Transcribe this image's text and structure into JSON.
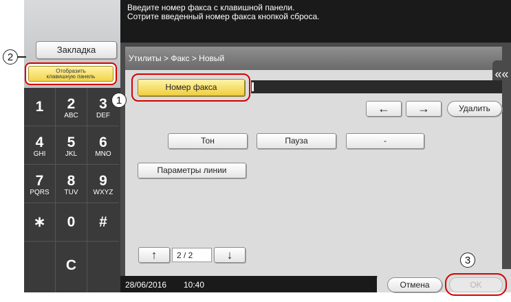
{
  "header": {
    "line1": "Введите номер факса с клавишной панели.",
    "line2": "Сотрите введенный номер факса кнопкой сброса."
  },
  "left": {
    "bookmark_label": "Закладка",
    "show_keypad_label_line1": "Отобразить",
    "show_keypad_label_line2": "клавишную панель"
  },
  "keypad": {
    "keys": [
      {
        "digit": "1",
        "letters": ""
      },
      {
        "digit": "2",
        "letters": "ABC"
      },
      {
        "digit": "3",
        "letters": "DEF"
      },
      {
        "digit": "4",
        "letters": "GHI"
      },
      {
        "digit": "5",
        "letters": "JKL"
      },
      {
        "digit": "6",
        "letters": "MNO"
      },
      {
        "digit": "7",
        "letters": "PQRS"
      },
      {
        "digit": "8",
        "letters": "TUV"
      },
      {
        "digit": "9",
        "letters": "WXYZ"
      },
      {
        "digit": "∗",
        "letters": ""
      },
      {
        "digit": "0",
        "letters": ""
      },
      {
        "digit": "#",
        "letters": ""
      }
    ],
    "clear_label": "C"
  },
  "main": {
    "breadcrumb": "Утилиты > Факс > Новый",
    "fax_number_label": "Номер факса",
    "fax_number_value": "",
    "side_tab_icon": "««",
    "left_arrow": "←",
    "right_arrow": "→",
    "delete_label": "Удалить",
    "tone_label": "Тон",
    "pause_label": "Пауза",
    "dash_label": "-",
    "line_params_label": "Параметры линии",
    "page_up": "↑",
    "page_down": "↓",
    "page_indicator": "2  / 2"
  },
  "footer": {
    "date": "28/06/2016",
    "time": "10:40",
    "cancel_label": "Отмена",
    "ok_label": "OK"
  },
  "callouts": {
    "one": "1",
    "two": "2",
    "three": "3"
  },
  "colors": {
    "highlight_ring": "#d40000",
    "active_button": "#f2d54a",
    "header_bg": "#1a1a1a"
  }
}
